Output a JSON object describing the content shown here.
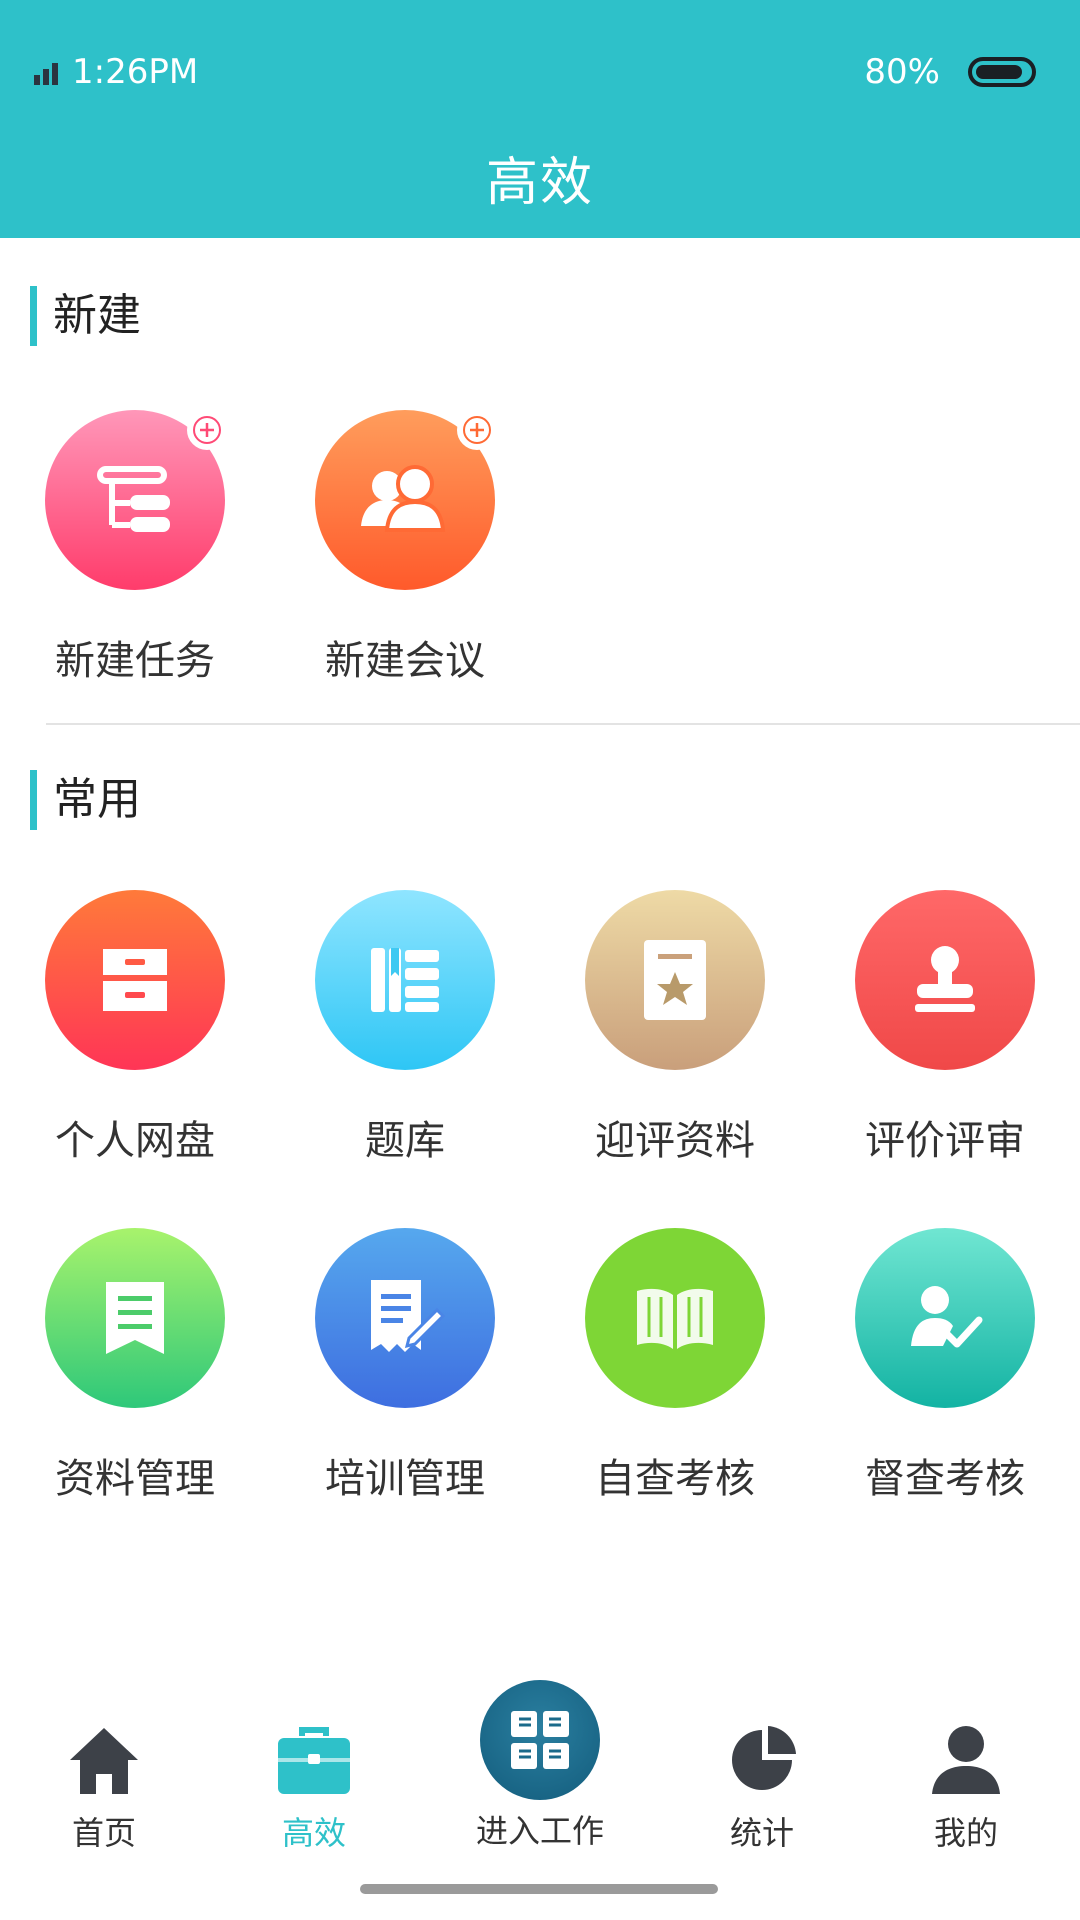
{
  "status_bar": {
    "time": "1:26PM",
    "battery": "80%"
  },
  "header": {
    "title": "高效"
  },
  "sections": {
    "new": {
      "title": "新建",
      "items": [
        {
          "label": "新建任务",
          "icon": "task-tree-icon",
          "colors": [
            "#ff8fb4",
            "#ff3d6e"
          ]
        },
        {
          "label": "新建会议",
          "icon": "meeting-people-icon",
          "colors": [
            "#ff9a5a",
            "#ff5a2a"
          ]
        }
      ]
    },
    "common": {
      "title": "常用",
      "items": [
        {
          "label": "个人网盘",
          "icon": "drawer-icon",
          "colors": [
            "#ff7a3c",
            "#ff3556"
          ]
        },
        {
          "label": "题库",
          "icon": "books-icon",
          "colors": [
            "#8be3ff",
            "#2ec7f5"
          ]
        },
        {
          "label": "迎评资料",
          "icon": "star-document-icon",
          "colors": [
            "#ecd8a4",
            "#c9a07a"
          ]
        },
        {
          "label": "评价评审",
          "icon": "stamp-icon",
          "colors": [
            "#ff6a6a",
            "#f24848"
          ]
        },
        {
          "label": "资料管理",
          "icon": "bookmark-list-icon",
          "colors": [
            "#a8f36c",
            "#2ec878"
          ]
        },
        {
          "label": "培训管理",
          "icon": "document-pen-icon",
          "colors": [
            "#54a6ee",
            "#3f6fe0"
          ]
        },
        {
          "label": "自查考核",
          "icon": "open-book-icon",
          "colors": [
            "#7ed636",
            "#7ed636"
          ]
        },
        {
          "label": "督查考核",
          "icon": "person-check-icon",
          "colors": [
            "#6ee6d0",
            "#12b3a3"
          ]
        }
      ]
    }
  },
  "nav": {
    "items": [
      {
        "label": "首页",
        "icon": "home-icon"
      },
      {
        "label": "高效",
        "icon": "briefcase-icon",
        "active": true
      },
      {
        "label": "进入工作",
        "icon": "hands-icon"
      },
      {
        "label": "统计",
        "icon": "pie-chart-icon"
      },
      {
        "label": "我的",
        "icon": "user-icon"
      }
    ]
  },
  "colors": {
    "accent": "#2ec1c9",
    "inactive_icon": "#3d4148"
  }
}
